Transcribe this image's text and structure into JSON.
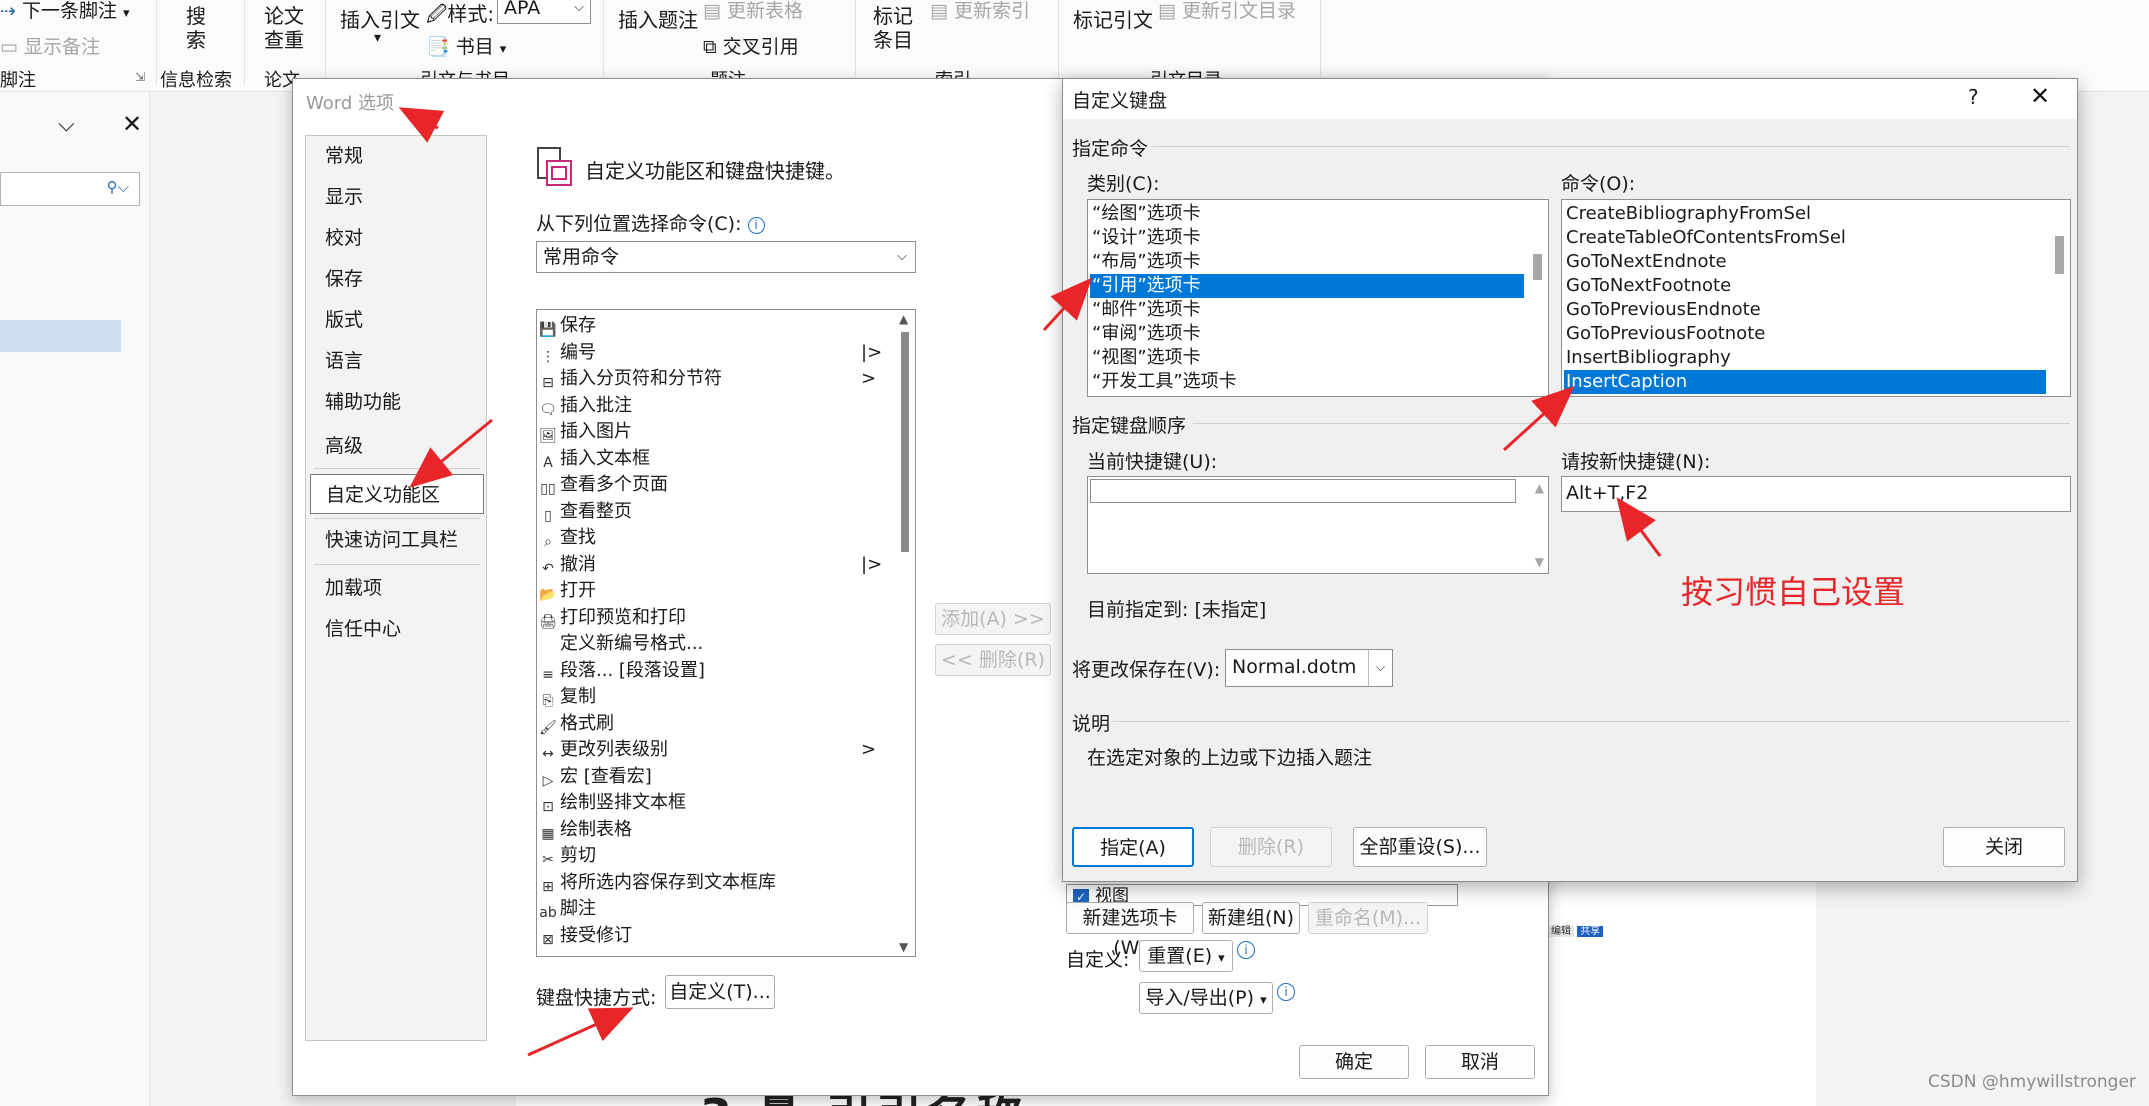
{
  "ribbon": {
    "next_footnote": "下一条脚注",
    "show_notes": "显示备注",
    "footnote_group": "脚注",
    "search": "搜\n索",
    "info_search": "信息检索",
    "paper_check": "论文\n查重",
    "paper": "论文",
    "insert_citation": "插入引文",
    "style_label": "样式:",
    "style_value": "APA",
    "bibliography": "书目",
    "citation_group": "引文与书目",
    "insert_caption": "插入题注",
    "update_table": "更新表格",
    "cross_ref": "交叉引用",
    "caption_group": "题注",
    "mark_entry": "标记\n条目",
    "update_index": "更新索引",
    "index_group": "索引",
    "mark_citation": "标记引文",
    "update_toa": "更新引文目录",
    "toa_group": "引文目录"
  },
  "word_options": {
    "title": "Word 选项",
    "nav": [
      "常规",
      "显示",
      "校对",
      "保存",
      "版式",
      "语言",
      "辅助功能",
      "高级",
      "自定义功能区",
      "快速访问工具栏",
      "加载项",
      "信任中心"
    ],
    "heading": "自定义功能区和键盘快捷键。",
    "choose_from_label": "从下列位置选择命令(C):",
    "choose_from_value": "常用命令",
    "commands": [
      {
        "label": "保存",
        "icon": "save-icon",
        "arrow": ""
      },
      {
        "label": "编号",
        "icon": "numbering-icon",
        "arrow": "|>"
      },
      {
        "label": "插入分页符和分节符",
        "icon": "page-break-icon",
        "arrow": ">"
      },
      {
        "label": "插入批注",
        "icon": "comment-icon",
        "arrow": ""
      },
      {
        "label": "插入图片",
        "icon": "picture-icon",
        "arrow": ""
      },
      {
        "label": "插入文本框",
        "icon": "textbox-icon",
        "arrow": ""
      },
      {
        "label": "查看多个页面",
        "icon": "multipage-icon",
        "arrow": ""
      },
      {
        "label": "查看整页",
        "icon": "page-icon",
        "arrow": ""
      },
      {
        "label": "查找",
        "icon": "find-icon",
        "arrow": ""
      },
      {
        "label": "撤消",
        "icon": "undo-icon",
        "arrow": "|>"
      },
      {
        "label": "打开",
        "icon": "open-icon",
        "arrow": ""
      },
      {
        "label": "打印预览和打印",
        "icon": "print-icon",
        "arrow": ""
      },
      {
        "label": "定义新编号格式...",
        "icon": "",
        "arrow": ""
      },
      {
        "label": "段落... [段落设置]",
        "icon": "paragraph-icon",
        "arrow": ""
      },
      {
        "label": "复制",
        "icon": "copy-icon",
        "arrow": ""
      },
      {
        "label": "格式刷",
        "icon": "format-painter-icon",
        "arrow": ""
      },
      {
        "label": "更改列表级别",
        "icon": "list-level-icon",
        "arrow": ">"
      },
      {
        "label": "宏 [查看宏]",
        "icon": "macro-icon",
        "arrow": ""
      },
      {
        "label": "绘制竖排文本框",
        "icon": "vertical-textbox-icon",
        "arrow": ""
      },
      {
        "label": "绘制表格",
        "icon": "draw-table-icon",
        "arrow": ""
      },
      {
        "label": "剪切",
        "icon": "cut-icon",
        "arrow": ""
      },
      {
        "label": "将所选内容保存到文本框库",
        "icon": "save-selection-icon",
        "arrow": ""
      },
      {
        "label": "脚注",
        "icon": "footnote-icon",
        "arrow": ""
      },
      {
        "label": "接受修订",
        "icon": "accept-icon",
        "arrow": ""
      }
    ],
    "add_btn": "添加(A) >>",
    "remove_btn": "<< 删除(R)",
    "view_item": "视图",
    "new_tab_btn": "新建选项卡(W)",
    "new_group_btn": "新建组(N)",
    "rename_btn": "重命名(M)...",
    "customize_label": "自定义:",
    "reset_btn": "重置(E)",
    "import_export_btn": "导入/导出(P)",
    "kb_label": "键盘快捷方式:",
    "kb_btn": "自定义(T)...",
    "ok": "确定",
    "cancel": "取消"
  },
  "keyboard_dialog": {
    "title": "自定义键盘",
    "help": "?",
    "specify_command": "指定命令",
    "category_label": "类别(C):",
    "categories": [
      "“绘图”选项卡",
      "“设计”选项卡",
      "“布局”选项卡",
      "“引用”选项卡",
      "“邮件”选项卡",
      "“审阅”选项卡",
      "“视图”选项卡",
      "“开发工具”选项卡"
    ],
    "category_selected": 3,
    "command_label": "命令(O):",
    "commands": [
      "CreateBibliographyFromSel",
      "CreateTableOfContentsFromSel",
      "GoToNextEndnote",
      "GoToNextFootnote",
      "GoToPreviousEndnote",
      "GoToPreviousFootnote",
      "InsertBibliography",
      "InsertCaption"
    ],
    "command_selected": 7,
    "specify_sequence": "指定键盘顺序",
    "current_keys_label": "当前快捷键(U):",
    "new_key_label": "请按新快捷键(N):",
    "new_key_value": "Alt+T,F2",
    "assigned_to": "目前指定到:  [未指定]",
    "save_in_label": "将更改保存在(V):",
    "save_in_value": "Normal.dotm",
    "description_label": "说明",
    "description": "在选定对象的上边或下边插入题注",
    "assign_btn": "指定(A)",
    "remove_btn": "删除(R)",
    "reset_all_btn": "全部重设(S)...",
    "close_btn": "关闭"
  },
  "annotation": "按习惯自己设置",
  "watermark": "CSDN @hmywillstronger",
  "accent_color": "#0078d7",
  "arrow_color": "#e8262a"
}
